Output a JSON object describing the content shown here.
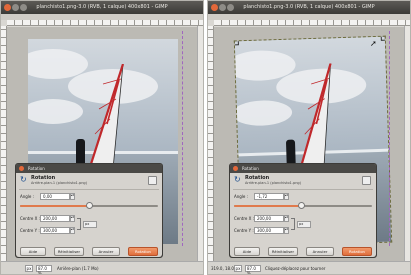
{
  "colors": {
    "accent": "#e06e3c",
    "titlebar": "#3b3a37",
    "dialog_bg": "#d6d3ce"
  },
  "left": {
    "title": "planchisto1.png-3.0 (RVB, 1 calque) 400x801 - GIMP",
    "status": {
      "units": "px",
      "zoom": "87.0 %",
      "info": "Arrière-plan (1.7 Mo)"
    },
    "dialog": {
      "title": "Rotation",
      "heading": "Rotation",
      "subtitle": "Arrière-plan-1 (planchisto1.png)",
      "angle_label": "Angle :",
      "angle_value": "0,00",
      "angle_fraction": 0.5,
      "center_x_label": "Centre X :",
      "center_x_value": "200,00",
      "center_y_label": "Centre Y :",
      "center_y_value": "300,00",
      "unit": "px",
      "buttons": [
        "Aide",
        "Réinitialiser",
        "Annuler",
        "Rotation"
      ]
    }
  },
  "right": {
    "title": "planchisto1.png-3.0 (RVB, 1 calque) 400x801 - GIMP",
    "status": {
      "coords": "319.0, 18.0",
      "units": "px",
      "zoom": "87.0 %",
      "info": "Cliquez-déplacez pour tourner"
    },
    "dialog": {
      "title": "Rotation",
      "heading": "Rotation",
      "subtitle": "Arrière-plan-1 (planchisto1.png)",
      "angle_label": "Angle :",
      "angle_value": "-1,72",
      "angle_fraction": 0.49,
      "center_x_label": "Centre X :",
      "center_x_value": "200,00",
      "center_y_label": "Centre Y :",
      "center_y_value": "300,00",
      "unit": "px",
      "buttons": [
        "Aide",
        "Réinitialiser",
        "Annuler",
        "Rotation"
      ]
    }
  },
  "icons": [
    "rotate-icon",
    "chain-link-icon",
    "mouse-pointer-icon",
    "spin-arrows-icon",
    "window-close-icon"
  ]
}
